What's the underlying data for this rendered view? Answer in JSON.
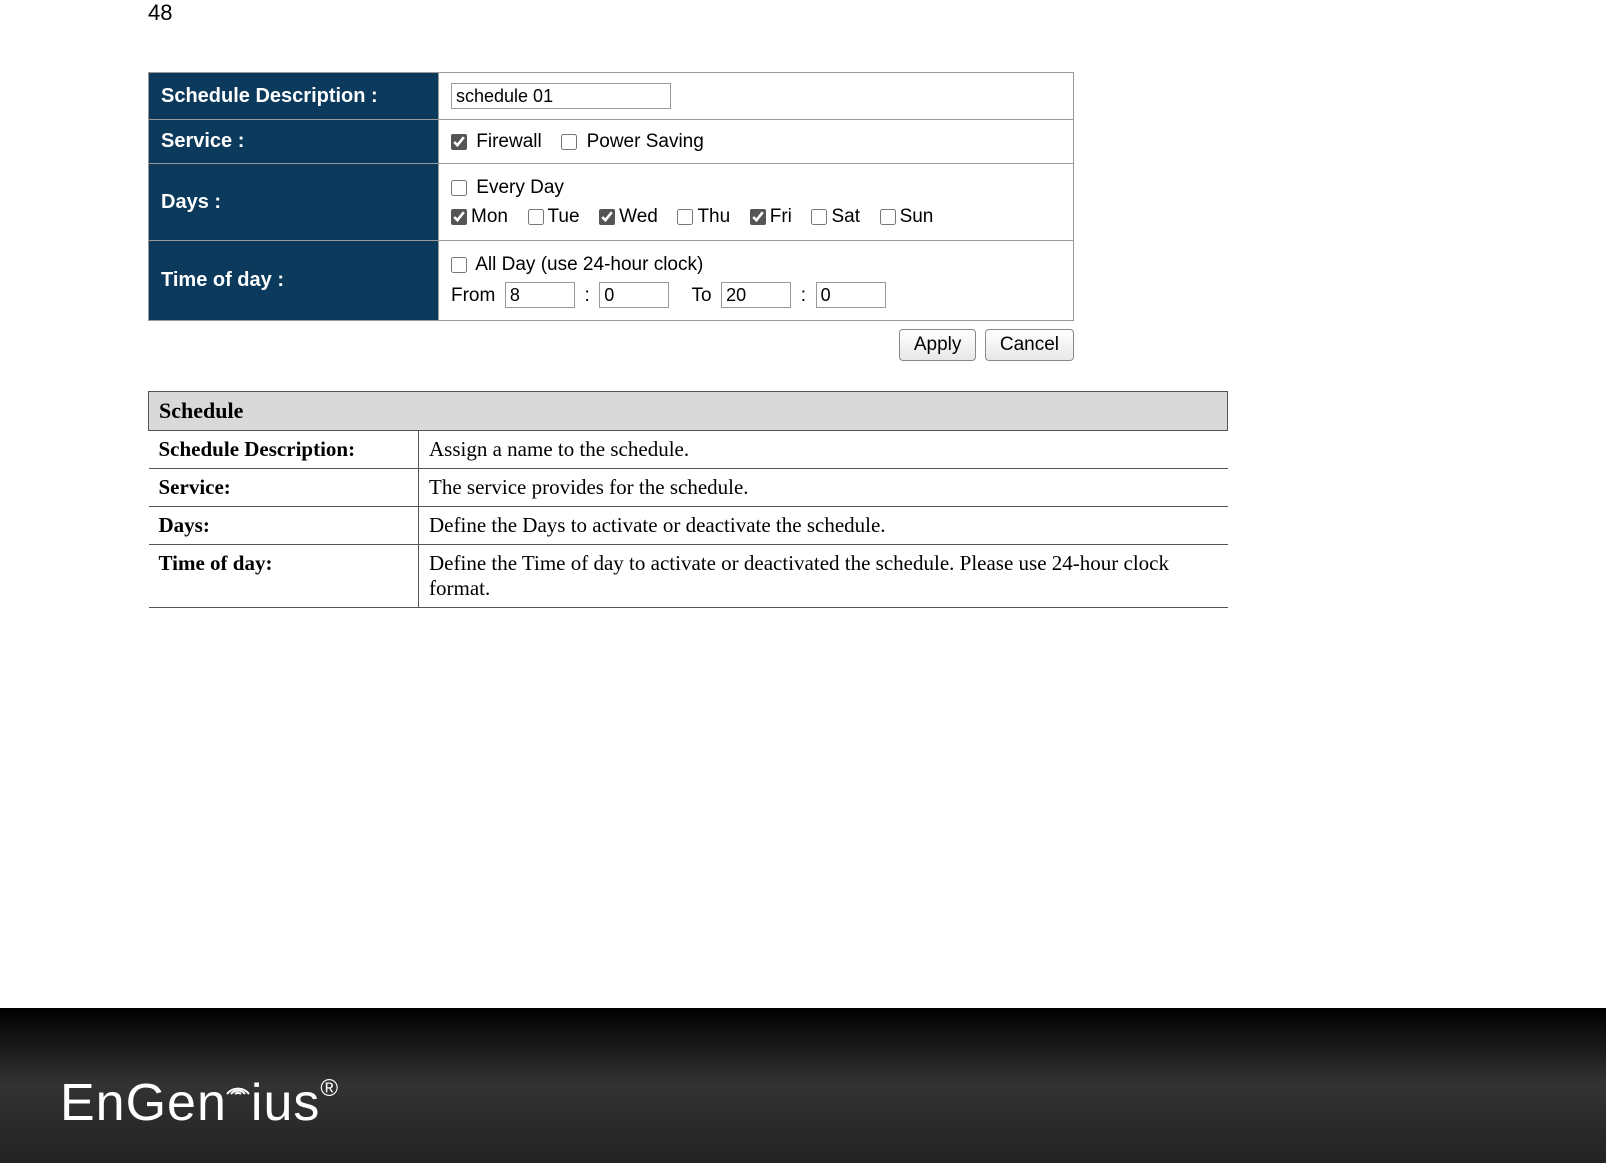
{
  "page_number": "48",
  "form": {
    "rows": {
      "schedule_desc": {
        "label": "Schedule Description :",
        "value": "schedule 01"
      },
      "service": {
        "label": "Service :",
        "options": [
          {
            "label": "Firewall",
            "checked": true
          },
          {
            "label": "Power Saving",
            "checked": false
          }
        ]
      },
      "days": {
        "label": "Days :",
        "every_day": {
          "label": "Every Day",
          "checked": false
        },
        "items": [
          {
            "label": "Mon",
            "checked": true
          },
          {
            "label": "Tue",
            "checked": false
          },
          {
            "label": "Wed",
            "checked": true
          },
          {
            "label": "Thu",
            "checked": false
          },
          {
            "label": "Fri",
            "checked": true
          },
          {
            "label": "Sat",
            "checked": false
          },
          {
            "label": "Sun",
            "checked": false
          }
        ]
      },
      "time": {
        "label": "Time of day :",
        "all_day": {
          "label": "All Day (use 24-hour clock)",
          "checked": false
        },
        "from_label": "From",
        "to_label": "To",
        "from_hour": "8",
        "from_min": "0",
        "to_hour": "20",
        "to_min": "0"
      }
    },
    "buttons": {
      "apply": "Apply",
      "cancel": "Cancel"
    }
  },
  "help": {
    "header": "Schedule",
    "rows": [
      {
        "key": "Schedule Description:",
        "val": "Assign a name to the schedule."
      },
      {
        "key": "Service:",
        "val": "The service provides for the schedule."
      },
      {
        "key": "Days:",
        "val": "Define the Days to activate or deactivate the schedule."
      },
      {
        "key": "Time of day:",
        "val": "Define the Time of day to activate or deactivated the schedule. Please use 24-hour clock format."
      }
    ]
  },
  "brand": {
    "name": "EnGenius",
    "reg": "®"
  }
}
